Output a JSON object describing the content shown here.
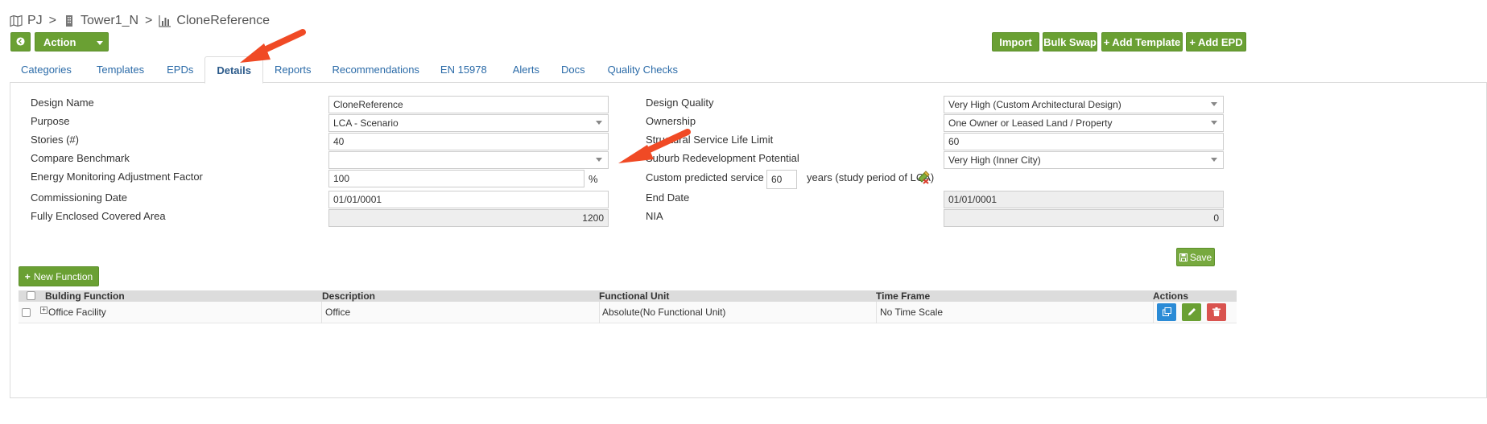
{
  "breadcrumb": {
    "project": "PJ",
    "building": "Tower1_N",
    "design": "CloneReference",
    "separator": ">"
  },
  "toolbar": {
    "action_label": "Action",
    "import_label": "Import",
    "bulk_swap_label": "Bulk Swap",
    "add_template_label": "Add Template",
    "add_epd_label": "Add EPD"
  },
  "tabs": [
    {
      "label": "Categories"
    },
    {
      "label": "Templates"
    },
    {
      "label": "EPDs"
    },
    {
      "label": "Details",
      "active": true
    },
    {
      "label": "Reports"
    },
    {
      "label": "Recommendations"
    },
    {
      "label": "EN 15978"
    },
    {
      "label": "Alerts"
    },
    {
      "label": "Docs"
    },
    {
      "label": "Quality Checks"
    }
  ],
  "details": {
    "design_name": {
      "label": "Design Name",
      "value": "CloneReference"
    },
    "purpose": {
      "label": "Purpose",
      "value": "LCA - Scenario"
    },
    "stories": {
      "label": "Stories (#)",
      "value": "40"
    },
    "compare_benchmark": {
      "label": "Compare Benchmark",
      "value": ""
    },
    "energy_factor": {
      "label": "Energy Monitoring Adjustment Factor",
      "value": "100",
      "unit": "%"
    },
    "commissioning_date": {
      "label": "Commissioning Date",
      "value": "01/01/0001"
    },
    "enclosed_area": {
      "label": "Fully Enclosed Covered Area",
      "value": "1200"
    },
    "design_quality": {
      "label": "Design Quality",
      "value": "Very High (Custom Architectural Design)"
    },
    "ownership": {
      "label": "Ownership",
      "value": "One Owner or Leased Land / Property"
    },
    "service_life_limit": {
      "label": "Structural Service Life Limit",
      "value": "60"
    },
    "redevelopment": {
      "label": "Suburb Redevelopment Potential",
      "value": "Very High (Inner City)"
    },
    "custom_life": {
      "label": "Custom predicted service life:",
      "value": "60",
      "suffix": "years (study period of LCA)"
    },
    "end_date": {
      "label": "End Date",
      "value": "01/01/0001"
    },
    "nia": {
      "label": "NIA",
      "value": "0"
    }
  },
  "save_label": "Save",
  "new_function_label": "New Function",
  "table": {
    "headers": {
      "function": "Bulding Function",
      "description": "Description",
      "unit": "Functional Unit",
      "time": "Time Frame",
      "actions": "Actions"
    },
    "rows": [
      {
        "function": "Office Facility",
        "description": "Office",
        "unit": "Absolute(No Functional Unit)",
        "time": "No Time Scale"
      }
    ]
  },
  "colors": {
    "green": "#6aa033",
    "blue": "#2b8bd6",
    "red": "#d9534f",
    "arrow": "#f04a25",
    "link": "#2b6ba8"
  }
}
